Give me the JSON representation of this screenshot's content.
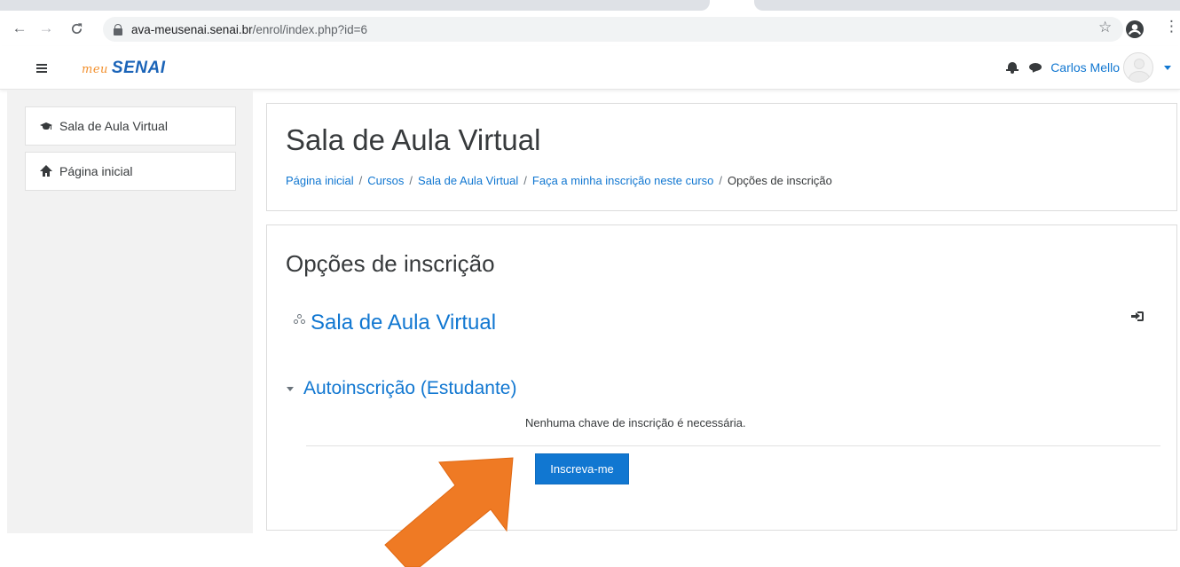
{
  "browser": {
    "url_host": "ava-meusenai.senai.br",
    "url_path": "/enrol/index.php?id=6",
    "icons": {
      "back": "arrow-left-icon",
      "forward": "arrow-right-icon",
      "reload": "reload-icon",
      "lock": "lock-icon",
      "bookmark": "star-icon",
      "profile": "account-circle-icon",
      "menu": "kebab-menu-icon"
    }
  },
  "navbar": {
    "logo_prefix": "meu",
    "logo_brand": "SENAI",
    "user_name": "Carlos Mello",
    "icons": {
      "drawer_toggle": "hamburger-icon",
      "notifications": "bell-icon",
      "messages": "chat-icon",
      "user_menu": "caret-down-icon"
    }
  },
  "drawer": {
    "items": [
      {
        "label": "Sala de Aula Virtual",
        "icon": "graduation-cap-icon"
      },
      {
        "label": "Página inicial",
        "icon": "home-icon"
      }
    ]
  },
  "header": {
    "title": "Sala de Aula Virtual",
    "breadcrumb": [
      "Página inicial",
      "Cursos",
      "Sala de Aula Virtual",
      "Faça a minha inscrição neste curso",
      "Opções de inscrição"
    ],
    "separator": "/"
  },
  "enrol": {
    "title": "Opções de inscrição",
    "course_name": "Sala de Aula Virtual",
    "course_icon": "course-icon",
    "enrol_icon": "sign-in-icon",
    "method_title": "Autoinscrição (Estudante)",
    "method_note": "Nenhuma chave de inscrição é necessária.",
    "button_label": "Inscreva-me"
  },
  "colors": {
    "link": "#1177d1",
    "button": "#1177d1",
    "drawer_bg": "#f2f2f2",
    "logo_orange": "#f28f2c",
    "logo_blue": "#1b64b8",
    "annotation_arrow": "#ef7a24"
  }
}
